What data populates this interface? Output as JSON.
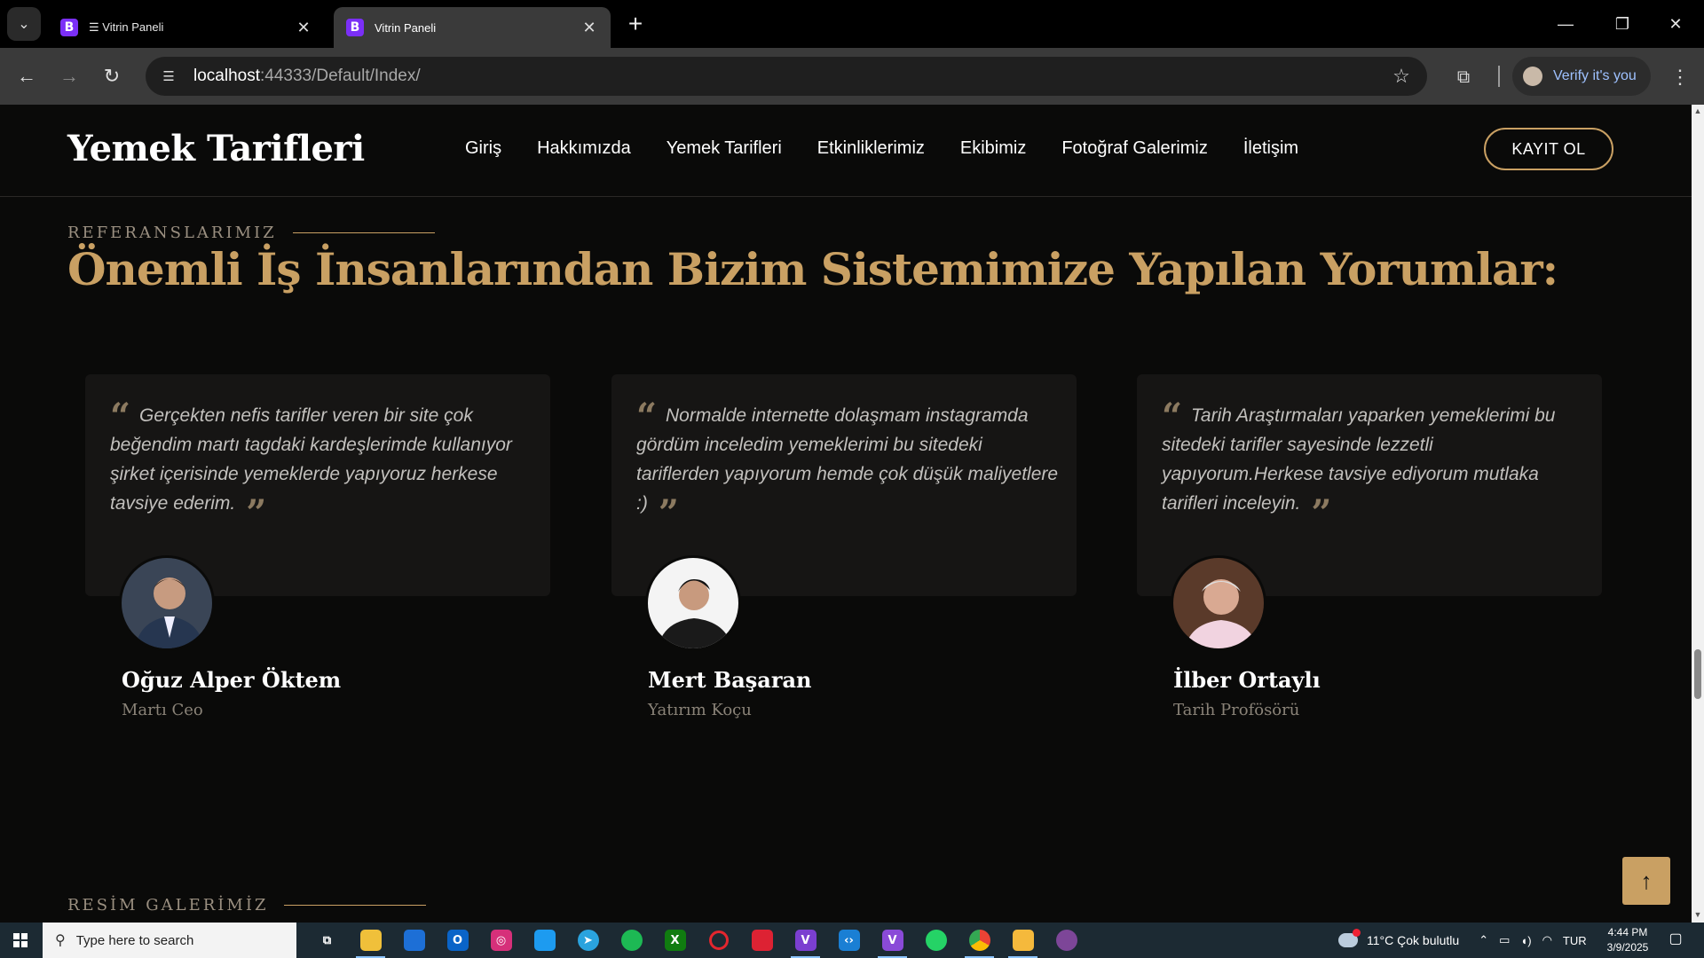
{
  "browser": {
    "tabs": [
      {
        "title": "☰ Vitrin Paneli",
        "favicon": "B",
        "active": false
      },
      {
        "title": "Vitrin Paneli",
        "favicon": "B",
        "active": true
      }
    ],
    "url_host": "localhost",
    "url_rest": ":44333/Default/Index/",
    "verify_label": "Verify it's you"
  },
  "site": {
    "logo": "Yemek Tarifleri",
    "nav": [
      "Giriş",
      "Hakkımızda",
      "Yemek Tarifleri",
      "Etkinliklerimiz",
      "Ekibimiz",
      "Fotoğraf Galerimiz",
      "İletişim"
    ],
    "register_label": "KAYIT OL"
  },
  "testimonials": {
    "eyebrow": "REFERANSLARIMIZ",
    "title": "Önemli İş İnsanlarından Bizim Sistemimize Yapılan Yorumlar:",
    "items": [
      {
        "quote": "Gerçekten nefis tarifler veren bir site çok beğendim martı tagdaki kardeşlerimde kullanıyor şirket içerisinde yemeklerde yapıyoruz herkese tavsiye ederim.",
        "name": "Oğuz Alper Öktem",
        "role": "Martı Ceo"
      },
      {
        "quote": "Normalde internette dolaşmam instagramda gördüm inceledim yemeklerimi bu sitedeki tariflerden yapıyorum hemde çok düşük maliyetlere :)",
        "name": "Mert Başaran",
        "role": "Yatırım Koçu"
      },
      {
        "quote": "Tarih Araştırmaları yaparken yemeklerimi bu sitedeki tarifler sayesinde lezzetli yapıyorum.Herkese tavsiye ediyorum mutlaka tarifleri inceleyin.",
        "name": "İlber Ortaylı",
        "role": "Tarih Profösörü"
      }
    ]
  },
  "gallery": {
    "eyebrow": "RESİM GALERİMİZ"
  },
  "taskbar": {
    "search_placeholder": "Type here to search",
    "weather": "11°C  Çok bulutlu",
    "lang": "TUR",
    "time": "4:44 PM",
    "date": "3/9/2025"
  },
  "colors": {
    "accent": "#c9a063",
    "background": "#0a0a09",
    "card": "#161514"
  }
}
